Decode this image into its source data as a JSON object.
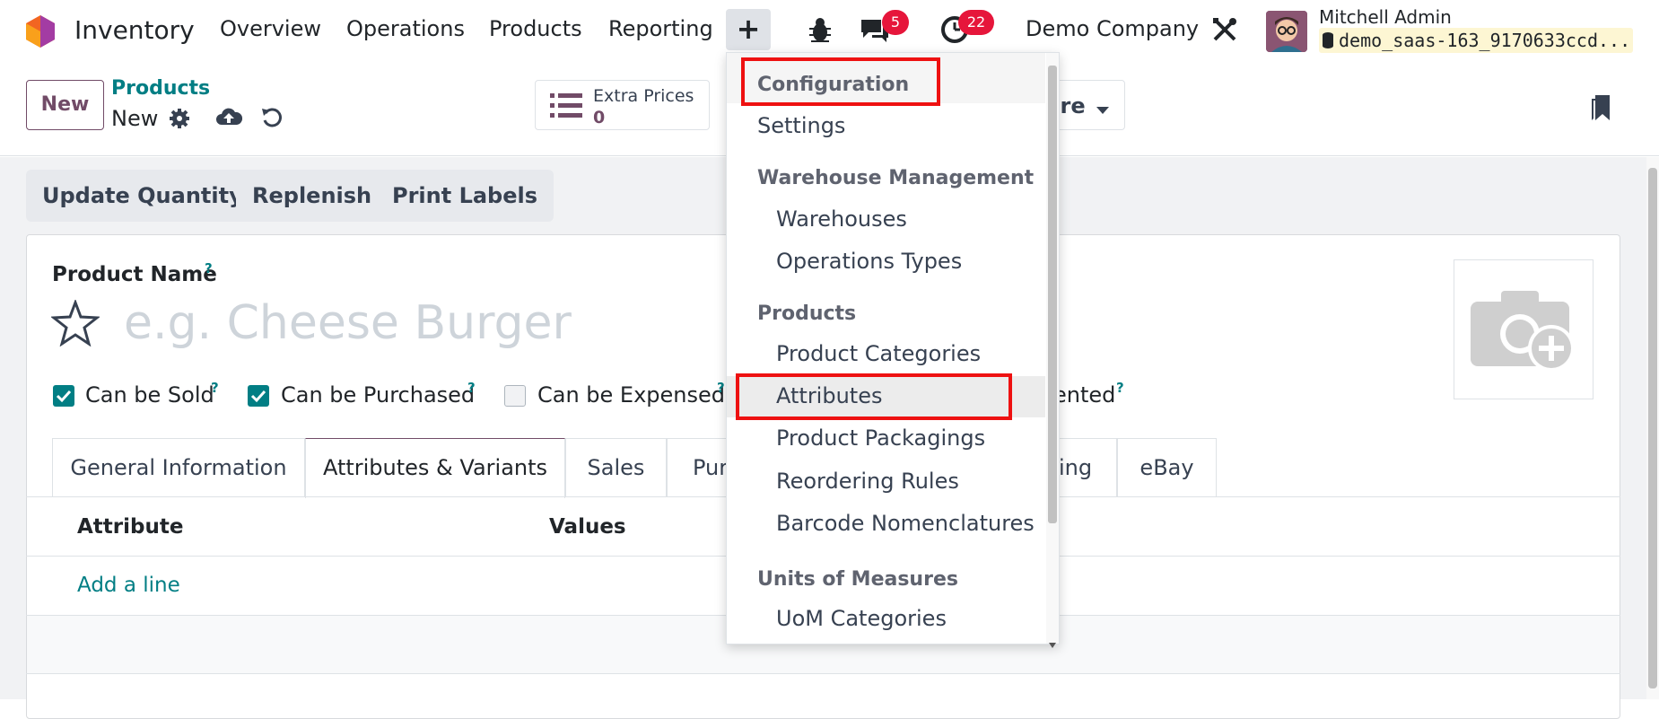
{
  "navbar": {
    "app_name": "Inventory",
    "menus": [
      "Overview",
      "Operations",
      "Products",
      "Reporting"
    ],
    "plus_symbol": "+",
    "messages_count": "5",
    "activities_count": "22",
    "company": "Demo Company",
    "user_name": "Mitchell Admin",
    "database": "demo_saas-163_9170633ccd..."
  },
  "control_panel": {
    "new_label": "New",
    "breadcrumb_parent": "Products",
    "record_name": "New",
    "extra_prices_label": "Extra Prices",
    "extra_prices_value": "0",
    "more_label": "ore"
  },
  "status_buttons": [
    "Update Quantity",
    "Replenish",
    "Print Labels"
  ],
  "form": {
    "product_name_label": "Product Name",
    "help_mark": "?",
    "name_placeholder": "e.g. Cheese Burger",
    "checkboxes": [
      {
        "label": "Can be Sold",
        "checked": true
      },
      {
        "label": "Can be Purchased",
        "checked": true
      },
      {
        "label": "Can be Expensed",
        "checked": false
      },
      {
        "label": "ented",
        "checked": null
      }
    ],
    "tabs": [
      "General Information",
      "Attributes & Variants",
      "Sales",
      "Pur",
      "ing",
      "eBay"
    ],
    "table_headers": {
      "attribute": "Attribute",
      "values": "Values"
    },
    "add_line": "Add a line"
  },
  "dropdown": {
    "configuration": "Configuration",
    "settings": "Settings",
    "warehouse_header": "Warehouse Management",
    "warehouses": "Warehouses",
    "operation_types": "Operations Types",
    "products_header": "Products",
    "product_categories": "Product Categories",
    "attributes": "Attributes",
    "product_packagings": "Product Packagings",
    "reordering_rules": "Reordering Rules",
    "barcode_nomenclatures": "Barcode Nomenclatures",
    "uom_header": "Units of Measures",
    "uom_categories": "UoM Categories"
  },
  "colors": {
    "brand": "#714b67",
    "teal": "#017e84",
    "highlight": "#ee1111",
    "badge": "#e6163b"
  }
}
